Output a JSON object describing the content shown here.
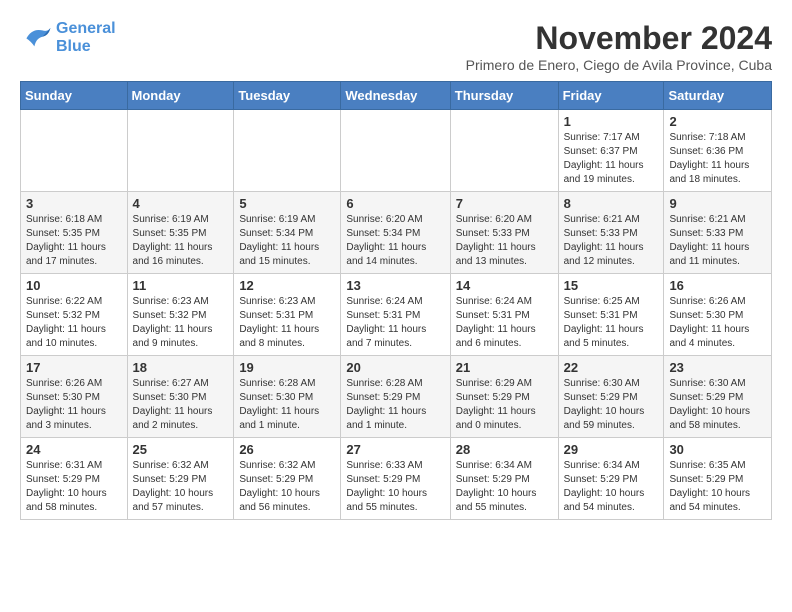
{
  "logo": {
    "line1": "General",
    "line2": "Blue"
  },
  "title": "November 2024",
  "location": "Primero de Enero, Ciego de Avila Province, Cuba",
  "weekdays": [
    "Sunday",
    "Monday",
    "Tuesday",
    "Wednesday",
    "Thursday",
    "Friday",
    "Saturday"
  ],
  "weeks": [
    [
      {
        "day": "",
        "info": ""
      },
      {
        "day": "",
        "info": ""
      },
      {
        "day": "",
        "info": ""
      },
      {
        "day": "",
        "info": ""
      },
      {
        "day": "",
        "info": ""
      },
      {
        "day": "1",
        "info": "Sunrise: 7:17 AM\nSunset: 6:37 PM\nDaylight: 11 hours and 19 minutes."
      },
      {
        "day": "2",
        "info": "Sunrise: 7:18 AM\nSunset: 6:36 PM\nDaylight: 11 hours and 18 minutes."
      }
    ],
    [
      {
        "day": "3",
        "info": "Sunrise: 6:18 AM\nSunset: 5:35 PM\nDaylight: 11 hours and 17 minutes."
      },
      {
        "day": "4",
        "info": "Sunrise: 6:19 AM\nSunset: 5:35 PM\nDaylight: 11 hours and 16 minutes."
      },
      {
        "day": "5",
        "info": "Sunrise: 6:19 AM\nSunset: 5:34 PM\nDaylight: 11 hours and 15 minutes."
      },
      {
        "day": "6",
        "info": "Sunrise: 6:20 AM\nSunset: 5:34 PM\nDaylight: 11 hours and 14 minutes."
      },
      {
        "day": "7",
        "info": "Sunrise: 6:20 AM\nSunset: 5:33 PM\nDaylight: 11 hours and 13 minutes."
      },
      {
        "day": "8",
        "info": "Sunrise: 6:21 AM\nSunset: 5:33 PM\nDaylight: 11 hours and 12 minutes."
      },
      {
        "day": "9",
        "info": "Sunrise: 6:21 AM\nSunset: 5:33 PM\nDaylight: 11 hours and 11 minutes."
      }
    ],
    [
      {
        "day": "10",
        "info": "Sunrise: 6:22 AM\nSunset: 5:32 PM\nDaylight: 11 hours and 10 minutes."
      },
      {
        "day": "11",
        "info": "Sunrise: 6:23 AM\nSunset: 5:32 PM\nDaylight: 11 hours and 9 minutes."
      },
      {
        "day": "12",
        "info": "Sunrise: 6:23 AM\nSunset: 5:31 PM\nDaylight: 11 hours and 8 minutes."
      },
      {
        "day": "13",
        "info": "Sunrise: 6:24 AM\nSunset: 5:31 PM\nDaylight: 11 hours and 7 minutes."
      },
      {
        "day": "14",
        "info": "Sunrise: 6:24 AM\nSunset: 5:31 PM\nDaylight: 11 hours and 6 minutes."
      },
      {
        "day": "15",
        "info": "Sunrise: 6:25 AM\nSunset: 5:31 PM\nDaylight: 11 hours and 5 minutes."
      },
      {
        "day": "16",
        "info": "Sunrise: 6:26 AM\nSunset: 5:30 PM\nDaylight: 11 hours and 4 minutes."
      }
    ],
    [
      {
        "day": "17",
        "info": "Sunrise: 6:26 AM\nSunset: 5:30 PM\nDaylight: 11 hours and 3 minutes."
      },
      {
        "day": "18",
        "info": "Sunrise: 6:27 AM\nSunset: 5:30 PM\nDaylight: 11 hours and 2 minutes."
      },
      {
        "day": "19",
        "info": "Sunrise: 6:28 AM\nSunset: 5:30 PM\nDaylight: 11 hours and 1 minute."
      },
      {
        "day": "20",
        "info": "Sunrise: 6:28 AM\nSunset: 5:29 PM\nDaylight: 11 hours and 1 minute."
      },
      {
        "day": "21",
        "info": "Sunrise: 6:29 AM\nSunset: 5:29 PM\nDaylight: 11 hours and 0 minutes."
      },
      {
        "day": "22",
        "info": "Sunrise: 6:30 AM\nSunset: 5:29 PM\nDaylight: 10 hours and 59 minutes."
      },
      {
        "day": "23",
        "info": "Sunrise: 6:30 AM\nSunset: 5:29 PM\nDaylight: 10 hours and 58 minutes."
      }
    ],
    [
      {
        "day": "24",
        "info": "Sunrise: 6:31 AM\nSunset: 5:29 PM\nDaylight: 10 hours and 58 minutes."
      },
      {
        "day": "25",
        "info": "Sunrise: 6:32 AM\nSunset: 5:29 PM\nDaylight: 10 hours and 57 minutes."
      },
      {
        "day": "26",
        "info": "Sunrise: 6:32 AM\nSunset: 5:29 PM\nDaylight: 10 hours and 56 minutes."
      },
      {
        "day": "27",
        "info": "Sunrise: 6:33 AM\nSunset: 5:29 PM\nDaylight: 10 hours and 55 minutes."
      },
      {
        "day": "28",
        "info": "Sunrise: 6:34 AM\nSunset: 5:29 PM\nDaylight: 10 hours and 55 minutes."
      },
      {
        "day": "29",
        "info": "Sunrise: 6:34 AM\nSunset: 5:29 PM\nDaylight: 10 hours and 54 minutes."
      },
      {
        "day": "30",
        "info": "Sunrise: 6:35 AM\nSunset: 5:29 PM\nDaylight: 10 hours and 54 minutes."
      }
    ]
  ]
}
